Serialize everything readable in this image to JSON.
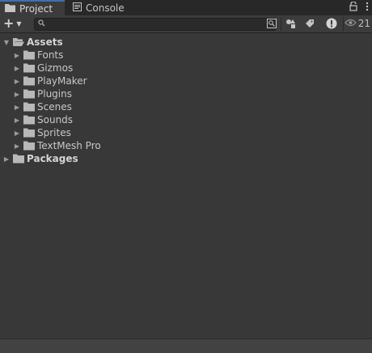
{
  "tabs": [
    {
      "label": "Project",
      "icon": "folder-icon",
      "active": true
    },
    {
      "label": "Console",
      "icon": "console-icon",
      "active": false
    }
  ],
  "tabbar_icons": [
    "lock-icon",
    "more-icon"
  ],
  "toolbar": {
    "add_icon": "plus-icon",
    "search_placeholder": "",
    "hidden_count": "21",
    "buttons": [
      "search-by-type-icon",
      "search-by-label-icon",
      "search-by-importance-icon",
      "hidden-packages-icon"
    ]
  },
  "tree": {
    "assets": {
      "label": "Assets",
      "expanded": true,
      "children": [
        "Fonts",
        "Gizmos",
        "PlayMaker",
        "Plugins",
        "Scenes",
        "Sounds",
        "Sprites",
        "TextMesh Pro"
      ]
    },
    "packages": {
      "label": "Packages",
      "expanded": false
    }
  },
  "colors": {
    "background": "#383838",
    "tabbar": "#282828",
    "active_tab_accent": "#3a72b0",
    "folder": "#b8b8b8"
  }
}
